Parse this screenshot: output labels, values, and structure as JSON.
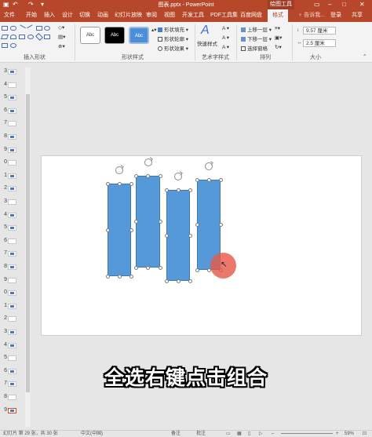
{
  "window": {
    "title": "图表.pptx - PowerPoint",
    "context_tab_group": "绘图工具"
  },
  "tabs": [
    "文件",
    "开始",
    "插入",
    "设计",
    "切换",
    "动画",
    "幻灯片放映",
    "审阅",
    "视图",
    "开发工具",
    "PDF工具集",
    "百度网盘",
    "格式"
  ],
  "active_tab": "格式",
  "tell_me": "♀ 告诉我...",
  "login": "登录",
  "share": "共享",
  "ribbon": {
    "groups": {
      "insert_shapes": "插入形状",
      "shape_styles": "形状样式",
      "wordart_styles": "艺术字样式",
      "arrange": "排列",
      "size": "大小"
    },
    "style_presets": [
      "Abc",
      "Abc",
      "Abc"
    ],
    "shape_fill": "形状填充",
    "shape_outline": "形状轮廓",
    "shape_effects": "形状效果",
    "quick_styles": "快速样式",
    "bring_forward": "上移一层",
    "send_backward": "下移一层",
    "selection_pane": "选择窗格",
    "height": "9.57 厘米",
    "width": "2.5 厘米"
  },
  "thumbnails": [
    {
      "num": "3"
    },
    {
      "num": "4"
    },
    {
      "num": "5"
    },
    {
      "num": "6"
    },
    {
      "num": "7"
    },
    {
      "num": "8"
    },
    {
      "num": "9"
    },
    {
      "num": "0"
    },
    {
      "num": "1"
    },
    {
      "num": "2"
    },
    {
      "num": "3"
    },
    {
      "num": "4"
    },
    {
      "num": "5"
    },
    {
      "num": "6"
    },
    {
      "num": "7"
    },
    {
      "num": "8"
    },
    {
      "num": "9"
    },
    {
      "num": "0"
    },
    {
      "num": "1"
    },
    {
      "num": "2"
    },
    {
      "num": "3"
    },
    {
      "num": "4"
    },
    {
      "num": "5"
    },
    {
      "num": "6"
    },
    {
      "num": "7"
    },
    {
      "num": "8"
    },
    {
      "num": "9"
    }
  ],
  "caption": "全选右键点击组合",
  "status": {
    "slide_info": "幻灯片 第 29 张，共 30 张",
    "language": "中文(中国)",
    "notes": "备注",
    "comments": "批注",
    "zoom": "59%"
  },
  "colors": {
    "accent": "#b7472a",
    "shape_fill": "#5699d9",
    "cursor_highlight": "#e75a4a"
  }
}
